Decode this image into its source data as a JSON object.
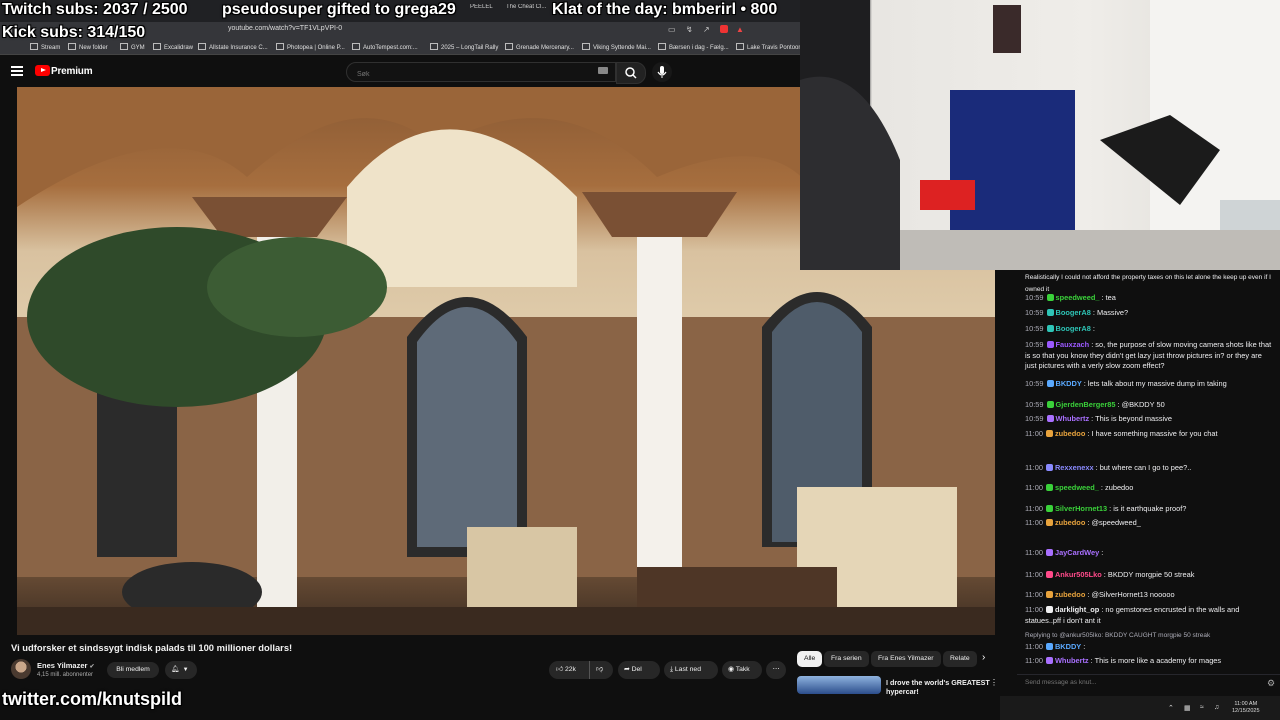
{
  "overlays": {
    "twitch_subs": "Twitch subs: 2037 / 2500",
    "gift_notice": "pseudosuper gifted to grega29",
    "clip_of_day": "Klat of the day: bmberirl • 800",
    "kick_subs": "Kick subs: 314/150",
    "twitter": "twitter.com/knutspild"
  },
  "browser": {
    "url": "youtube.com/watch?v=TF1VLpVPI-0",
    "tabs": [
      "The Cheat Cl...",
      "PEELEL"
    ],
    "bookmarks": [
      "Stream",
      "New folder",
      "GYM",
      "Excalidraw",
      "Allstate Insurance C...",
      "Photopea | Online P...",
      "AutoTempest.com:...",
      "2025 – LongTail Rally",
      "Grenade Mercenary...",
      "Viking Syttende Mai...",
      "Bærsen i dag - Fælg...",
      "Lake Travis Pontoon..."
    ]
  },
  "youtube": {
    "brand": "Premium",
    "search_placeholder": "Søk",
    "video_title": "Vi udforsker et sindssygt indisk palads til 100 millioner dollars!",
    "channel_name": "Enes Yilmazer",
    "subscribers": "4,15 mill. abonnenter",
    "join_label": "Bli medlem",
    "likes": "22k",
    "share_label": "Del",
    "download_label": "Last ned",
    "thanks_label": "Takk",
    "chips": [
      "Alle",
      "Fra serien",
      "Fra Enes Yilmazer",
      "Relate"
    ],
    "rec_title": "I drove the world's GREATEST hypercar!"
  },
  "chat": {
    "input_placeholder": "Send message as knut...",
    "messages": [
      {
        "time": "",
        "user": "",
        "color": "#efeff1",
        "text": "Realistically I could not afford the property taxes on this let alone the keep up even if I owned it"
      },
      {
        "time": "10:59",
        "user": "speedweed_",
        "color": "#3ad13a",
        "text": "tea"
      },
      {
        "time": "10:59",
        "user": "BoogerA8",
        "color": "#2ec4b6",
        "text": "Massive?"
      },
      {
        "time": "10:59",
        "user": "BoogerA8",
        "color": "#2ec4b6",
        "text": ""
      },
      {
        "time": "10:59",
        "user": "Fauxzach",
        "color": "#9b59ff",
        "text": "so, the purpose of slow moving camera shots like that is so that you know they didn't get lazy just throw pictures in? or they are just pictures with a verly slow zoom effect?"
      },
      {
        "time": "10:59",
        "user": "BKDDY",
        "color": "#5aa9ff",
        "text": "lets talk about my massive dump im taking"
      },
      {
        "time": "10:59",
        "user": "GjerdenBerger85",
        "color": "#3ad13a",
        "text": "@BKDDY 50"
      },
      {
        "time": "10:59",
        "user": "Whubertz",
        "color": "#a970ff",
        "text": "This is beyond massive"
      },
      {
        "time": "11:00",
        "user": "zubedoo",
        "color": "#e8a33d",
        "text": "I have something massive for you chat"
      },
      {
        "time": "11:00",
        "user": "Rexxenexx",
        "color": "#8a8aff",
        "text": "but where can I go to pee?.."
      },
      {
        "time": "11:00",
        "user": "speedweed_",
        "color": "#3ad13a",
        "text": "zubedoo"
      },
      {
        "time": "11:00",
        "user": "SilverHornet13",
        "color": "#3ad13a",
        "text": "is it earthquake proof?"
      },
      {
        "time": "11:00",
        "user": "zubedoo",
        "color": "#e8a33d",
        "text": "@speedweed_"
      },
      {
        "time": "11:00",
        "user": "JayCardWey",
        "color": "#a970ff",
        "text": ""
      },
      {
        "time": "11:00",
        "user": "Ankur505Lko",
        "color": "#ff4a8a",
        "text": "BKDDY morgpie 50 streak"
      },
      {
        "time": "11:00",
        "user": "zubedoo",
        "color": "#e8a33d",
        "text": "@SilverHornet13 nooooo"
      },
      {
        "time": "11:00",
        "user": "darklight_op",
        "color": "#efeff1",
        "text": "no gemstones encrusted in the walls and statues..pff i don't ant it"
      },
      {
        "time": "",
        "user": "",
        "color": "#adadb8",
        "text": "Replying to @ankur505lko: BKDDY CAUGHT morgpie 50 streak"
      },
      {
        "time": "11:00",
        "user": "BKDDY",
        "color": "#5aa9ff",
        "text": ""
      },
      {
        "time": "11:00",
        "user": "Whubertz",
        "color": "#a970ff",
        "text": "This is more like a academy for mages"
      }
    ]
  },
  "system": {
    "time": "11:00 AM",
    "date": "12/15/2025"
  }
}
